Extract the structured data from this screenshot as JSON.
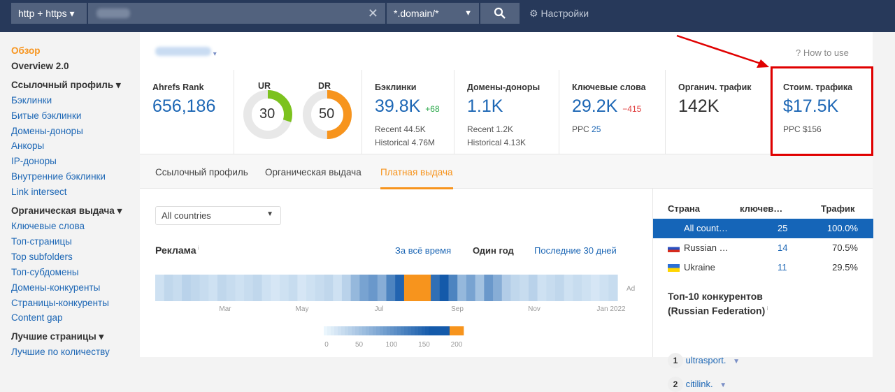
{
  "topbar": {
    "protocol": "http + https",
    "search_value": "",
    "mode": "*.domain/*",
    "settings": "Настройки"
  },
  "sidebar": {
    "items": [
      {
        "label": "Обзор",
        "type": "active"
      },
      {
        "label": "Overview 2.0",
        "type": "head"
      },
      {
        "label": "Ссылочный профиль ▾",
        "type": "head"
      },
      {
        "label": "Бэклинки",
        "type": "link"
      },
      {
        "label": "Битые бэклинки",
        "type": "link"
      },
      {
        "label": "Домены-доноры",
        "type": "link"
      },
      {
        "label": "Анкоры",
        "type": "link"
      },
      {
        "label": "IP-доноры",
        "type": "link"
      },
      {
        "label": "Внутренние бэклинки",
        "type": "link"
      },
      {
        "label": "Link intersect",
        "type": "link"
      },
      {
        "label": "Органическая выдача ▾",
        "type": "head"
      },
      {
        "label": "Ключевые слова",
        "type": "link"
      },
      {
        "label": "Топ-страницы",
        "type": "link"
      },
      {
        "label": "Top subfolders",
        "type": "link"
      },
      {
        "label": "Топ-субдомены",
        "type": "link"
      },
      {
        "label": "Домены-конкуренты",
        "type": "link"
      },
      {
        "label": "Страницы-конкуренты",
        "type": "link"
      },
      {
        "label": "Content gap",
        "type": "link"
      },
      {
        "label": "Лучшие страницы ▾",
        "type": "head"
      },
      {
        "label": "Лучшие по количеству",
        "type": "link"
      }
    ]
  },
  "header": {
    "how_to_use": "How to use"
  },
  "metrics": {
    "ahrefs_rank": {
      "label": "Ahrefs Rank",
      "value": "656,186"
    },
    "ur": {
      "label": "UR",
      "value": "30",
      "percent": 30,
      "color": "#7cc21e"
    },
    "dr": {
      "label": "DR",
      "value": "50",
      "percent": 50,
      "color": "#f7941d"
    },
    "backlinks": {
      "label": "Бэклинки",
      "value": "39.8K",
      "delta": "+68",
      "recent": "Recent 44.5K",
      "historical": "Historical 4.76M"
    },
    "ref_domains": {
      "label": "Домены-доноры",
      "value": "1.1K",
      "recent": "Recent 1.2K",
      "historical": "Historical 4.13K"
    },
    "keywords": {
      "label": "Ключевые слова",
      "value": "29.2K",
      "delta": "−415",
      "ppc_label": "PPC",
      "ppc_value": "25"
    },
    "organic_traffic": {
      "label": "Органич. трафик",
      "value": "142K"
    },
    "traffic_cost": {
      "label": "Стоим. трафика",
      "value": "$17.5K",
      "ppc": "PPC $156"
    }
  },
  "tabs": [
    {
      "label": "Ссылочный профиль"
    },
    {
      "label": "Органическая выдача"
    },
    {
      "label": "Платная выдача",
      "active": true
    }
  ],
  "filter": {
    "country": "All countries"
  },
  "ads": {
    "title": "Реклама",
    "ranges": [
      "За всё время",
      "Один год",
      "Последние 30 дней"
    ],
    "active_range": "Один год",
    "row_label": "Ad"
  },
  "chart_data": {
    "type": "heatmap",
    "title": "Реклама",
    "row_label": "Ad",
    "x_tick_labels": [
      "Mar",
      "May",
      "Jul",
      "Sep",
      "Nov",
      "Jan 2022"
    ],
    "values": [
      20,
      30,
      25,
      35,
      30,
      25,
      20,
      30,
      25,
      20,
      25,
      30,
      20,
      15,
      20,
      25,
      15,
      20,
      25,
      30,
      20,
      35,
      60,
      80,
      90,
      70,
      110,
      140,
      200,
      200,
      200,
      130,
      150,
      110,
      60,
      80,
      50,
      90,
      70,
      40,
      30,
      25,
      35,
      20,
      25,
      30,
      20,
      25,
      20,
      15,
      20,
      25
    ],
    "legend_ticks": [
      "0",
      "50",
      "100",
      "150",
      "200"
    ],
    "color_range": [
      0,
      200
    ]
  },
  "countries": {
    "headers": [
      "Страна",
      "ключев…",
      "Трафик"
    ],
    "rows": [
      {
        "name": "All count…",
        "keywords": "25",
        "traffic": "100.0%",
        "selected": true
      },
      {
        "name": "Russian …",
        "keywords": "14",
        "traffic": "70.5%",
        "flag": "ru"
      },
      {
        "name": "Ukraine",
        "keywords": "11",
        "traffic": "29.5%",
        "flag": "ua"
      }
    ]
  },
  "competitors": {
    "title_line1": "Топ-10 конкурентов",
    "title_line2": "(Russian Federation)",
    "items": [
      {
        "rank": "1",
        "name": "ultrasport."
      },
      {
        "rank": "2",
        "name": "citilink."
      }
    ]
  },
  "colors": {
    "accent": "#f7941d",
    "link": "#1d67b5",
    "highlight": "#e00000"
  }
}
